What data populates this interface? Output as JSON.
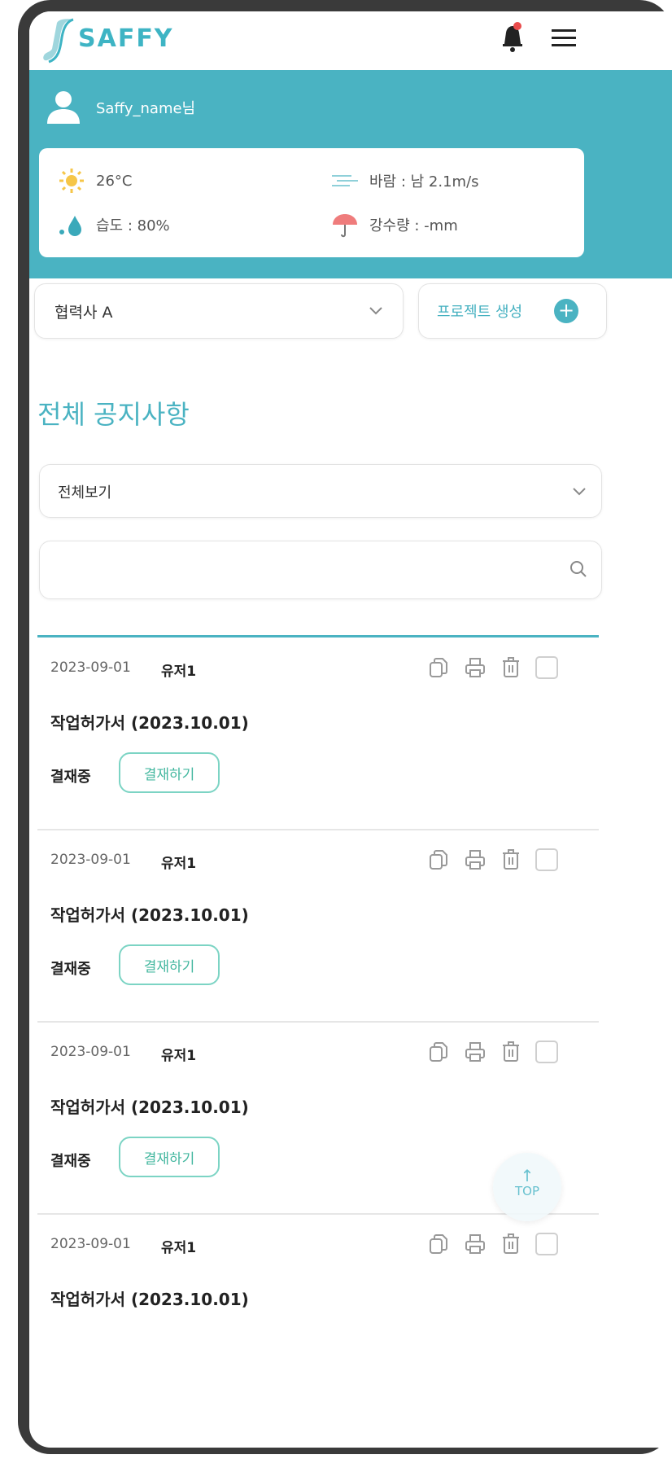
{
  "app": {
    "brand": "SAFFY",
    "accent": "#4ab3c2"
  },
  "header": {
    "notification_icon": "bell-icon",
    "menu_icon": "hamburger-icon"
  },
  "user": {
    "name": "Saffy_name님"
  },
  "weather": {
    "temperature": "26°C",
    "wind": "바람 : 남 2.1m/s",
    "humidity": "습도 : 80%",
    "rainfall": "강수량 : -mm"
  },
  "company": {
    "selected": "협력사 A"
  },
  "create_project": {
    "label": "프로젝트 생성"
  },
  "page": {
    "title": "전체 공지사항"
  },
  "filter": {
    "selected": "전체보기"
  },
  "search": {
    "value": "",
    "placeholder": ""
  },
  "items": [
    {
      "date": "2023-09-01",
      "user": "유저1",
      "title": "작업허가서 (2023.10.01)",
      "status": "결재중",
      "action": "결재하기"
    },
    {
      "date": "2023-09-01",
      "user": "유저1",
      "title": "작업허가서 (2023.10.01)",
      "status": "결재중",
      "action": "결재하기"
    },
    {
      "date": "2023-09-01",
      "user": "유저1",
      "title": "작업허가서 (2023.10.01)",
      "status": "결재중",
      "action": "결재하기"
    },
    {
      "date": "2023-09-01",
      "user": "유저1",
      "title": "작업허가서 (2023.10.01)",
      "status": "",
      "action": ""
    }
  ],
  "scroll_top": {
    "label": "TOP"
  }
}
